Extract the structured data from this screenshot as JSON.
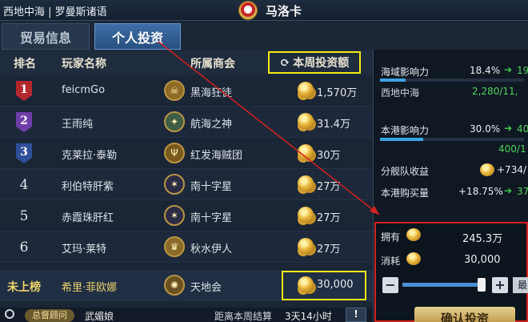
{
  "header": {
    "region": "西地中海 | 罗曼斯诸语",
    "city": "马洛卡"
  },
  "tabs": [
    {
      "label": "贸易信息",
      "active": false
    },
    {
      "label": "个人投资",
      "active": true
    }
  ],
  "table": {
    "columns": {
      "rank": "排名",
      "player": "玩家名称",
      "guild": "所属商会",
      "weekly": "本周投资额"
    },
    "rows": [
      {
        "rank": "1",
        "player": "feicmGo",
        "guild": "黑海狂徒",
        "amount": "1,570万",
        "guild_icon": "skull-crest-icon"
      },
      {
        "rank": "2",
        "player": "王雨纯",
        "guild": "航海之神",
        "amount": "31.4万",
        "guild_icon": "compass-crest-icon"
      },
      {
        "rank": "3",
        "player": "克莱拉·泰勒",
        "guild": "红发海贼团",
        "amount": "30万",
        "guild_icon": "trident-crest-icon"
      },
      {
        "rank": "4",
        "player": "利伯特肝紫",
        "guild": "南十字星",
        "amount": "27万",
        "guild_icon": "star-crest-icon"
      },
      {
        "rank": "5",
        "player": "赤霞珠肝红",
        "guild": "南十字星",
        "amount": "27万",
        "guild_icon": "star-crest-icon"
      },
      {
        "rank": "6",
        "player": "艾玛·莱特",
        "guild": "秋水伊人",
        "amount": "27万",
        "guild_icon": "crown-crest-icon"
      }
    ],
    "mine": {
      "rank": "未上榜",
      "player": "希里·菲欧娜",
      "guild": "天地会",
      "amount": "30,000"
    }
  },
  "bottom": {
    "advisor_badge": "总督顾问",
    "advisor_name": "武媚娘",
    "settle_label": "距离本周结算",
    "settle_time": "3天14小时",
    "info_label": "!"
  },
  "right": {
    "sea": {
      "label": "海域影响力",
      "value": "18.4%",
      "arrow": "➔",
      "next": "19",
      "fill": 0.18
    },
    "region": {
      "label": "西地中海",
      "value": "2,280/11,"
    },
    "port": {
      "label": "本港影响力",
      "value": "30.0%",
      "arrow": "➔",
      "next": "40",
      "fill": 0.3,
      "progress": "400/1"
    },
    "fleet": {
      "label": "分舰队收益",
      "value": "+734/",
      "icon": "gold-coins-icon"
    },
    "purchase": {
      "label": "本港购买量",
      "value": "+18.75%",
      "arrow": "➔",
      "next": "37"
    },
    "invest": {
      "own_label": "拥有",
      "own_value": "245.3万",
      "cost_label": "消耗",
      "cost_value": "30,000",
      "minus": "−",
      "plus": "+",
      "max": "最",
      "slider_level": 0.95,
      "confirm": "确认投资"
    }
  },
  "colors": {
    "highlight": "#f2ea10",
    "annotation": "#d42121",
    "positive": "#4fd35a"
  }
}
